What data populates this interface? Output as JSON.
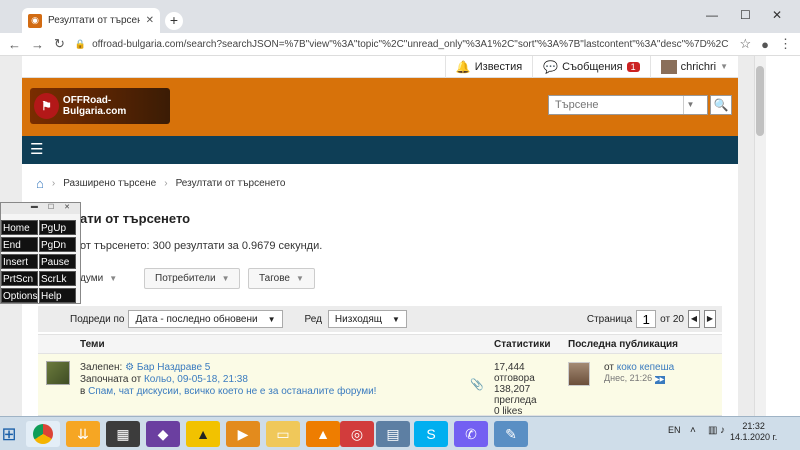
{
  "browser": {
    "tab_title": "Резултати от търсенето - OFFR",
    "tab_close": "✕",
    "new_tab": "+",
    "url": "offroad-bulgaria.com/search?searchJSON=%7B\"view\"%3A\"topic\"%2C\"unread_only\"%3A1%2C\"sort\"%3A%7B\"lastcontent\"%3A\"desc\"%7D%2C\"exclu"
  },
  "userbar": {
    "notifications": "Известия",
    "messages": "Съобщения",
    "messages_count": "1",
    "username": "chrichri"
  },
  "header": {
    "logo_text": "OFFRoad-Bulgaria.com",
    "search_placeholder": "Търсене"
  },
  "breadcrumb": {
    "items": [
      "Разширено търсене",
      "Резултати от търсенето"
    ]
  },
  "page": {
    "title": "ати от търсенето",
    "summary": "от търсенето: 300 резултати за 0.9679 секунди."
  },
  "filters": {
    "words": "думи",
    "users": "Потребители",
    "tags": "Тагове"
  },
  "sortbar": {
    "order_label": "Подреди по",
    "order_value": "Дата - последно обновени",
    "row_label": "Ред",
    "row_value": "Низходящ",
    "page_label": "Страница",
    "page_num": "1",
    "page_of": "от 20"
  },
  "columns": {
    "topics": "Теми",
    "stats": "Статистики",
    "last": "Последна публикация"
  },
  "row": {
    "sticky_label": "Залепен:",
    "topic_title": "Бар Наздраве 5",
    "started_by": "Започната от",
    "author": "Кольо",
    "date": ", 09-05-18, 21:38",
    "in_label": "в",
    "forum": "Спам, чат дискусии, всичко което не е за останалите форуми!",
    "replies": "17,444",
    "replies_label": "отговора",
    "views": "138,207",
    "views_label": "прегледа",
    "likes": "0 likes",
    "last_from": "от",
    "last_user": "коко кепеша",
    "last_time": "Днес, 21:26"
  },
  "keyboard": {
    "keys": [
      "Home",
      "PgUp",
      "End",
      "PgDn",
      "Insert",
      "Pause",
      "PrtScn",
      "ScrLk",
      "Options",
      "Help"
    ]
  },
  "taskbar": {
    "lang": "EN",
    "time": "21:32",
    "date": "14.1.2020 г."
  }
}
